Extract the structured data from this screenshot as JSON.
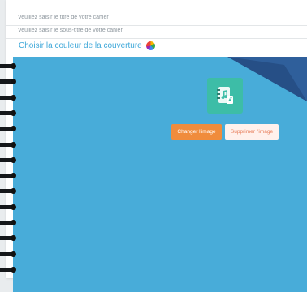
{
  "form": {
    "title_placeholder": "Veuillez saisir le titre de votre cahier",
    "subtitle_placeholder": "Veuillez saisir le sous-titre de votre cahier",
    "color_label": "Choisir la couleur de la couverture"
  },
  "cover": {
    "background_color": "#48acd9",
    "image_icon": "notebook-music-icon",
    "change_image_label": "Changer l'image",
    "delete_image_label": "Supprimer l'image",
    "spiral_rings": 14
  },
  "colors": {
    "accent": "#3fa8d9",
    "change_button": "#f08c3c",
    "delete_button_bg": "#fff1ec",
    "delete_button_text": "#e77d59",
    "image_tile": "#3dbda7"
  }
}
